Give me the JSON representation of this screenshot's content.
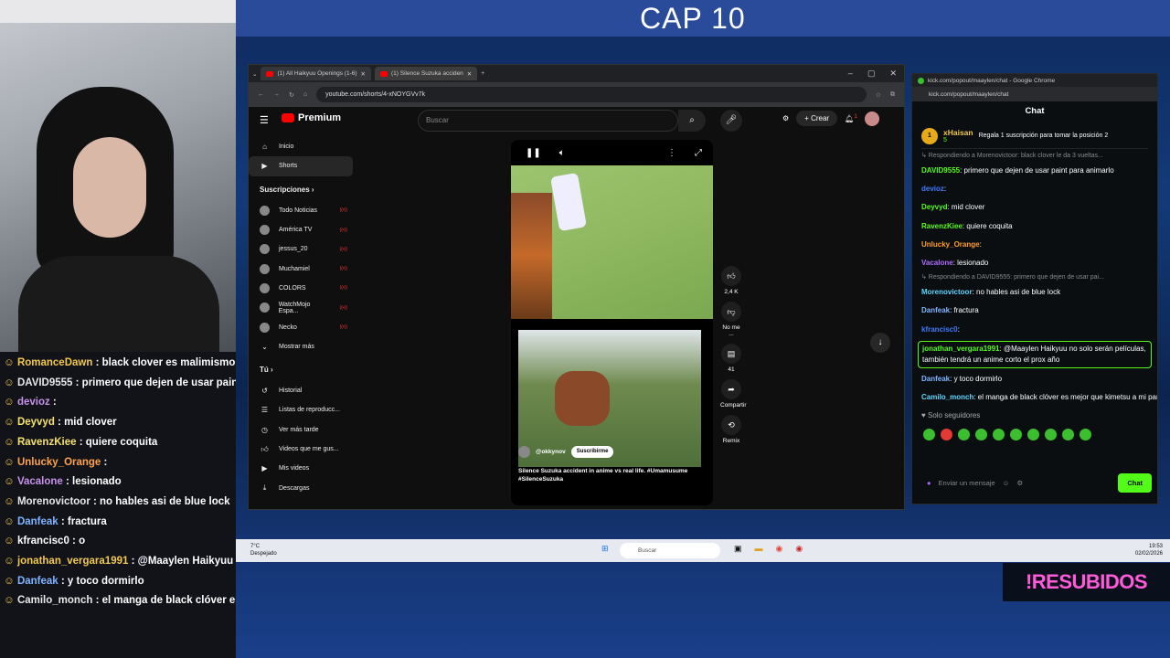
{
  "overlay": {
    "title": "CAP 10",
    "resub_label": "!RESUBIDOS"
  },
  "stream_chat": [
    {
      "user": "RomanceDawn",
      "msg": " : black clover es malimismo, indefendible",
      "color": "u-g"
    },
    {
      "user": "DAVID9555",
      "msg": " : primero que dejen de usar paint p",
      "color": "u-c"
    },
    {
      "user": "devioz",
      "msg": " :",
      "color": "u-p"
    },
    {
      "user": "Deyvyd",
      "msg": " : mid clover",
      "color": "u-y"
    },
    {
      "user": "RavenzKiee",
      "msg": " : quiere coquita",
      "color": "u-y"
    },
    {
      "user": "Unlucky_Orange",
      "msg": " :",
      "color": "u-o"
    },
    {
      "user": "Vacalone",
      "msg": " : lesionado",
      "color": "u-p"
    },
    {
      "user": "Morenovictoor",
      "msg": " : no hables asi de blue lock",
      "color": "u-c"
    },
    {
      "user": "Danfeak",
      "msg": " : fractura",
      "color": "u-b"
    },
    {
      "user": "kfrancisc0",
      "msg": " : o",
      "color": "u-l"
    },
    {
      "user": "jonathan_vergara1991",
      "msg": " : @Maaylen Haikyuu también tendrá un anime corto el prox año",
      "color": "u-g"
    },
    {
      "user": "Danfeak",
      "msg": " : y toco dormirlo",
      "color": "u-b"
    },
    {
      "user": "Camilo_monch",
      "msg": " : el manga de black clóver es m",
      "color": "u-c"
    }
  ],
  "browser": {
    "tabs": [
      {
        "label": "(1) All Haikyuu Openings (1-6)"
      },
      {
        "label": "(1) Silence Suzuka acciden"
      }
    ],
    "url": "youtube.com/shorts/4-xNOYGVv7k"
  },
  "youtube": {
    "logo": "Premium",
    "search_placeholder": "Buscar",
    "create_label": "Crear",
    "notif_count": "1",
    "nav": [
      {
        "label": "Inicio"
      },
      {
        "label": "Shorts"
      }
    ],
    "subs_header": "Suscripciones",
    "subs": [
      {
        "label": "Todo Noticias"
      },
      {
        "label": "América TV"
      },
      {
        "label": "jessus_20"
      },
      {
        "label": "Muchamiel"
      },
      {
        "label": "COLORS"
      },
      {
        "label": "WatchMojo Espa..."
      },
      {
        "label": "Necko"
      }
    ],
    "show_more": "Mostrar más",
    "you_header": "Tú",
    "you_items": [
      {
        "label": "Historial"
      },
      {
        "label": "Listas de reproducc..."
      },
      {
        "label": "Ver más tarde"
      },
      {
        "label": "Videos que me gus..."
      },
      {
        "label": "Mis videos"
      },
      {
        "label": "Descargas"
      }
    ],
    "short": {
      "channel": "@okkynov",
      "subscribe": "Suscribirme",
      "caption": "Silence Suzuka accident in anime vs real life. #Umamusume #SilenceSuzuka"
    },
    "actions": [
      {
        "label": "2,4 K"
      },
      {
        "label": "No me ..."
      },
      {
        "label": "41"
      },
      {
        "label": "Compartir"
      },
      {
        "label": "Remix"
      }
    ]
  },
  "kick": {
    "window_title": "kick.com/popout/maaylen/chat - Google Chrome",
    "url": "kick.com/popout/maaylen/chat",
    "title": "Chat",
    "gift_rank": "1",
    "gift_user": "xHaisan",
    "gift_count": "5",
    "gift_text": "Regala 1 suscripción para tomar la posición 2",
    "messages": [
      {
        "type": "reply",
        "text": "↳ Respondiendo a Morenovictoor: black clover le da 3 vueltas..."
      },
      {
        "user": "DAVID9555",
        "msg": ": primero que dejen de usar paint para animarlo",
        "color": "kn-g"
      },
      {
        "user": "devioz",
        "msg": ":",
        "color": "kn-b"
      },
      {
        "user": "Deyvyd",
        "msg": ": mid clover",
        "color": "kn-g"
      },
      {
        "user": "RavenzKiee",
        "msg": ": quiere coquita",
        "color": "kn-g"
      },
      {
        "user": "Unlucky_Orange",
        "msg": ":",
        "color": "kn-o"
      },
      {
        "user": "Vacalone",
        "msg": ": lesionado",
        "color": "kn-p"
      },
      {
        "type": "reply",
        "text": "↳ Respondiendo a DAVID9555: primero que dejen de usar pai..."
      },
      {
        "user": "Morenovictoor",
        "msg": ": no hables asi de blue lock",
        "color": "kn-c"
      },
      {
        "user": "Danfeak",
        "msg": ": fractura",
        "color": "kn-l"
      },
      {
        "user": "kfrancisc0",
        "msg": ":",
        "color": "kn-b"
      }
    ],
    "highlight": {
      "user": "jonathan_vergara1991",
      "msg": ": @Maaylen Haikyuu no solo serán películas, también tendrá un anime corto el prox año"
    },
    "messages2": [
      {
        "user": "Danfeak",
        "msg": ": y toco dormirlo",
        "color": "kn-l"
      },
      {
        "user": "Camilo_monch",
        "msg": ": el manga de black clóver es mejor que kimetsu a mi parecer",
        "color": "kn-c"
      }
    ],
    "followers_only": "Solo seguidores",
    "input_placeholder": "Enviar un mensaje",
    "send_label": "Chat"
  },
  "taskbar": {
    "weather_temp": "7°C",
    "weather_desc": "Despejado",
    "search": "Buscar",
    "time": "19:53",
    "date": "02/02/2026"
  }
}
